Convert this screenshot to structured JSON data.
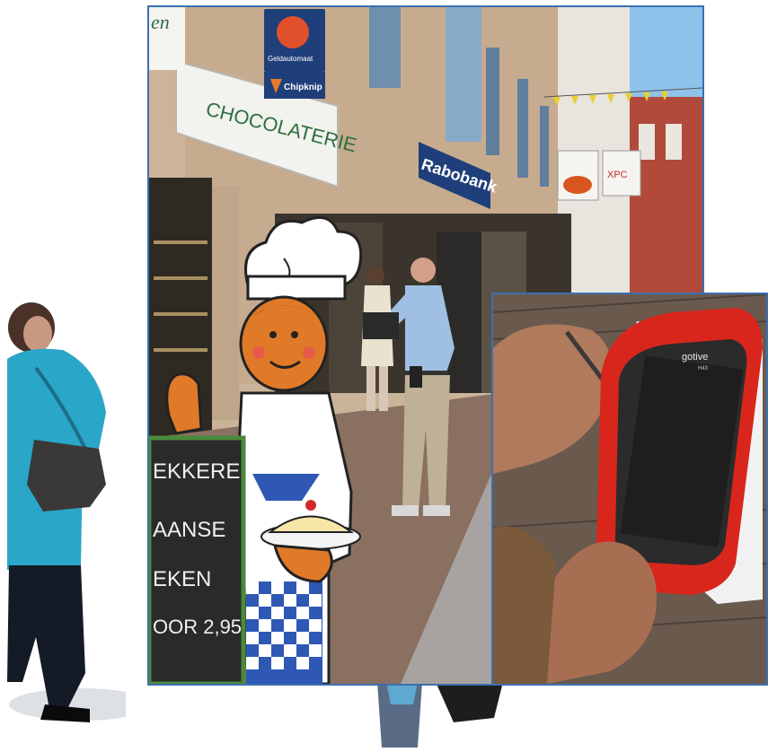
{
  "street_scene": {
    "chocolaterie_sign": "CHOCOLATERIE",
    "geldautomaat_sign": "Geldautomaat",
    "chipknip_sign": "Chipknip",
    "rabobank_sign": "Rabobank",
    "corner_sign_fragment": "en",
    "xpc_sign": "XPC",
    "chalkboard_lines": [
      "EKKERE",
      "AANSE",
      "EKEN",
      "OOR 2,95"
    ]
  },
  "device": {
    "brand": "gotive",
    "model": "H43"
  },
  "colors": {
    "frame_border": "#3a70b0",
    "device_red": "#d8261c",
    "rabobank_blue": "#1f3f7a",
    "chocolaterie_green": "#2e6e3c"
  }
}
